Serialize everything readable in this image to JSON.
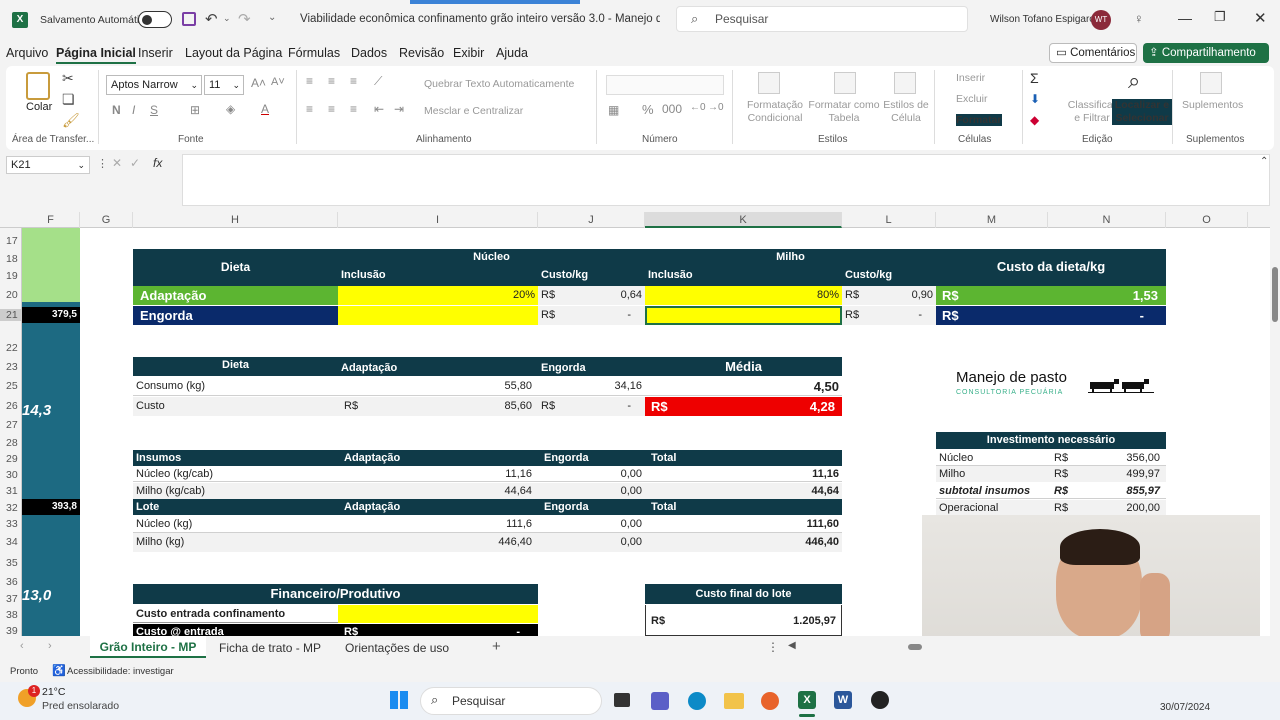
{
  "titlebar": {
    "autosave": "Salvamento Automático",
    "doc_title": "Viabilidade econômica confinamento grão inteiro versão 3.0 - Manejo de Pa...",
    "search": "Pesquisar",
    "user": "Wilson Tofano Espigaroli",
    "avatar": "WT"
  },
  "menu": [
    "Arquivo",
    "Página Inicial",
    "Inserir",
    "Layout da Página",
    "Fórmulas",
    "Dados",
    "Revisão",
    "Exibir",
    "Ajuda"
  ],
  "comments_btn": "Comentários",
  "share_btn": "Compartilhamento",
  "ribbon": {
    "paste": "Colar",
    "clipboard": "Área de Transfer...",
    "font_name": "Aptos Narrow",
    "font_size": "11",
    "font_group": "Fonte",
    "wrap": "Quebrar Texto Automaticamente",
    "merge": "Mesclar e Centralizar",
    "align_group": "Alinhamento",
    "number_group": "Número",
    "cond_format": "Formatação Condicional",
    "format_table": "Formatar como Tabela",
    "cell_styles": "Estilos de Célula",
    "styles_group": "Estilos",
    "insert": "Inserir",
    "delete": "Excluir",
    "format": "Formatar",
    "cells_group": "Células",
    "sort_filter": "Classificar e Filtrar",
    "find_select": "Localizar e Selecionar",
    "edit_group": "Edição",
    "addins": "Suplementos",
    "addins_group": "Suplementos"
  },
  "namebox": "K21",
  "columns": [
    "F",
    "G",
    "H",
    "I",
    "J",
    "K",
    "L",
    "M",
    "N",
    "O"
  ],
  "rows": [
    "17",
    "18",
    "19",
    "20",
    "21",
    "22",
    "23",
    "24",
    "25",
    "26",
    "27",
    "28",
    "29",
    "30",
    "31",
    "32",
    "33",
    "34",
    "35",
    "36",
    "37",
    "38",
    "39"
  ],
  "left_col": {
    "v1": "379,5",
    "v2": "14,3",
    "v3": "393,8",
    "v4": "13,0"
  },
  "dieta_table": {
    "h_dieta": "Dieta",
    "h_nucleo": "Núcleo",
    "h_milho": "Milho",
    "h_inclusao1": "Inclusão",
    "h_custo1": "Custo/kg",
    "h_inclusao2": "Inclusão",
    "h_custo2": "Custo/kg",
    "h_custo_dieta": "Custo da dieta/kg",
    "r1": {
      "label": "Adaptação",
      "inc1": "20%",
      "rs1": "R$",
      "c1": "0,64",
      "inc2": "80%",
      "rs2": "R$",
      "c2": "0,90",
      "rs3": "R$",
      "total": "1,53"
    },
    "r2": {
      "label": "Engorda",
      "rs1": "R$",
      "c1": "-",
      "rs2": "R$",
      "c2": "-",
      "rs3": "R$",
      "total": "-"
    }
  },
  "consumo_table": {
    "h_dieta": "Dieta",
    "h_adapt": "Adaptação",
    "h_engorda": "Engorda",
    "h_media": "Média",
    "consumo_label": "Consumo (kg)",
    "consumo_adapt": "55,80",
    "consumo_eng": "34,16",
    "consumo_media": "4,50",
    "custo_label": "Custo",
    "rs_a": "R$",
    "custo_adapt": "85,60",
    "rs_e": "R$",
    "custo_eng": "-",
    "rs_m": "R$",
    "custo_media": "4,28"
  },
  "insumos_table": {
    "h1": "Insumos",
    "h2": "Adaptação",
    "h3": "Engorda",
    "h4": "Total",
    "rows": [
      {
        "label": "Núcleo (kg/cab)",
        "a": "11,16",
        "e": "0,00",
        "t": "11,16"
      },
      {
        "label": "Milho (kg/cab)",
        "a": "44,64",
        "e": "0,00",
        "t": "44,64"
      }
    ],
    "h5": "Lote",
    "h6": "Adaptação",
    "h7": "Engorda",
    "h8": "Total",
    "rows2": [
      {
        "label": "Núcleo (kg)",
        "a": "111,6",
        "e": "0,00",
        "t": "111,60"
      },
      {
        "label": "Milho (kg)",
        "a": "446,40",
        "e": "0,00",
        "t": "446,40"
      }
    ]
  },
  "logo": {
    "main": "Manejo de pasto",
    "sub": "CONSULTORIA PECUÁRIA"
  },
  "invest_table": {
    "title": "Investimento necessário",
    "rows": [
      {
        "label": "Núcleo",
        "rs": "R$",
        "v": "356,00"
      },
      {
        "label": "Milho",
        "rs": "R$",
        "v": "499,97"
      },
      {
        "label": "subtotal insumos",
        "rs": "R$",
        "v": "855,97"
      },
      {
        "label": "Operacional",
        "rs": "R$",
        "v": "200,00"
      }
    ]
  },
  "fin_table": {
    "title": "Financeiro/Produtivo",
    "r1": "Custo entrada confinamento",
    "r2": "Custo @ entrada",
    "rs": "R$",
    "r2v": "-"
  },
  "custo_final": {
    "title": "Custo final do lote",
    "rs": "R$",
    "v": "1.205,97"
  },
  "tabs": [
    "Grão Inteiro - MP",
    "Ficha de trato - MP",
    "Orientações de uso"
  ],
  "status": {
    "ready": "Pronto",
    "access": "Acessibilidade: investigar"
  },
  "taskbar": {
    "temp": "21°C",
    "weather": "Pred ensolarado",
    "search": "Pesquisar",
    "date": "30/07/2024",
    "badge": "1"
  },
  "colors": {
    "dark": "#0f3a48",
    "green": "#5cb531",
    "navy": "#0a2a6b",
    "yellow": "#ffff00",
    "red": "#ee0000",
    "excel": "#1e7145",
    "light_green": "#a5e089"
  }
}
